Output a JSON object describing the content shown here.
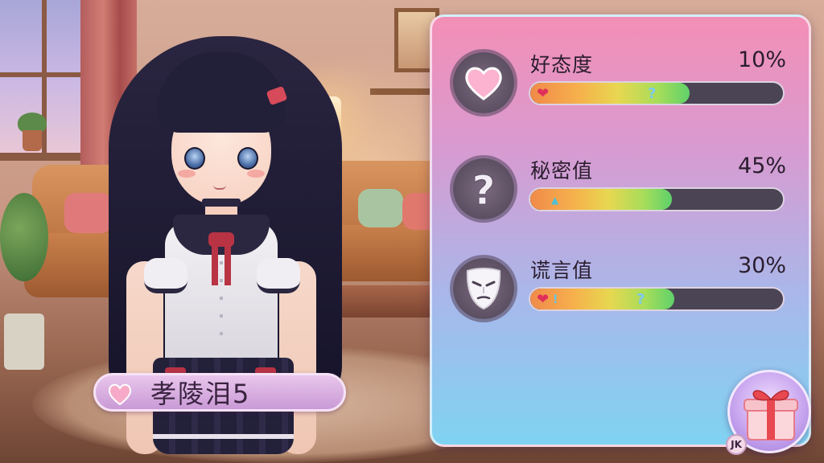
{
  "character": {
    "name": "孝陵泪5"
  },
  "stats": [
    {
      "label": "好态度",
      "value_text": "10%",
      "fill": 0.63,
      "icon": "heart-icon"
    },
    {
      "label": "秘密值",
      "value_text": "45%",
      "fill": 0.56,
      "icon": "question-mark-icon"
    },
    {
      "label": "谎言值",
      "value_text": "30%",
      "fill": 0.57,
      "icon": "mask-icon"
    }
  ],
  "gift": {
    "icon": "gift-box-icon",
    "badge": "JK"
  },
  "colors": {
    "panel_top": "#f38fb6",
    "panel_bottom": "#7fd3f2",
    "bar_track": "#4a4454",
    "heart": "#f58ab0"
  }
}
